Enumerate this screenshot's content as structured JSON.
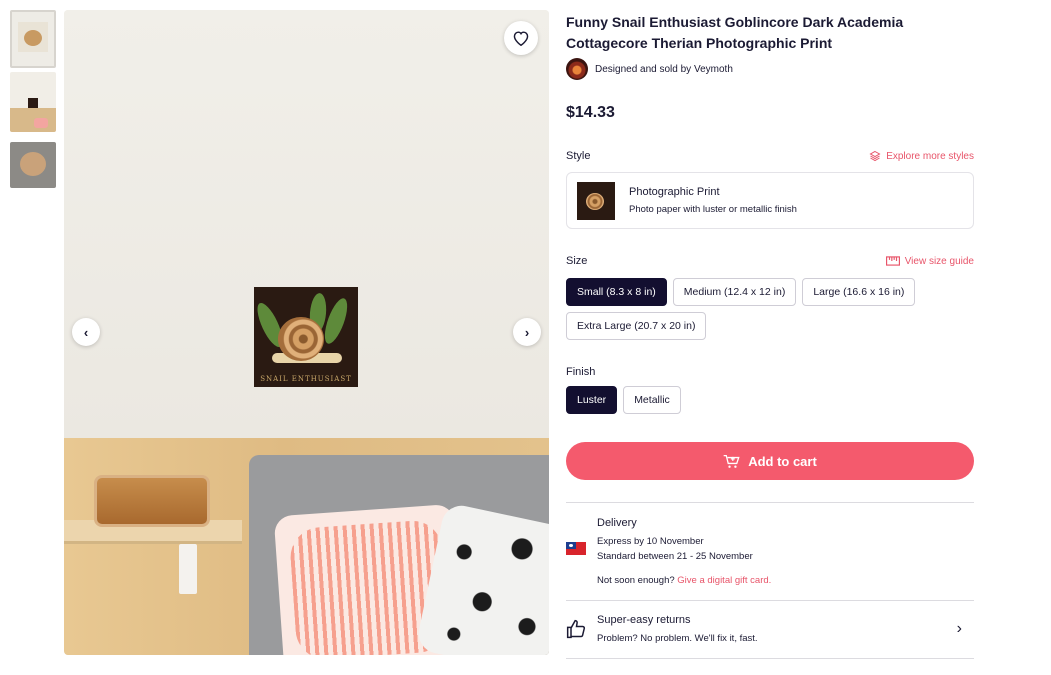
{
  "product": {
    "title": "Funny Snail Enthusiast Goblincore Dark Academia Cottagecore Therian Photographic Print",
    "seller_prefix": "Designed and sold by",
    "seller_name": "Veymoth",
    "price": "$14.33"
  },
  "gallery": {
    "art_caption": "SNAIL ENTHUSIAST",
    "prev_icon": "chevron-left-icon",
    "next_icon": "chevron-right-icon",
    "favorite_icon": "heart-icon"
  },
  "style": {
    "label": "Style",
    "explore_link": "Explore more styles",
    "selected_name": "Photographic Print",
    "selected_desc": "Photo paper with luster or metallic finish"
  },
  "size": {
    "label": "Size",
    "guide_link": "View size guide",
    "options": [
      {
        "label": "Small (8.3 x 8 in)",
        "selected": true
      },
      {
        "label": "Medium (12.4 x 12 in)",
        "selected": false
      },
      {
        "label": "Large (16.6 x 16 in)",
        "selected": false
      },
      {
        "label": "Extra Large (20.7 x 20 in)",
        "selected": false
      }
    ]
  },
  "finish": {
    "label": "Finish",
    "options": [
      {
        "label": "Luster",
        "selected": true
      },
      {
        "label": "Metallic",
        "selected": false
      }
    ]
  },
  "cart": {
    "label": "Add to cart"
  },
  "delivery": {
    "heading": "Delivery",
    "express": "Express by 10 November",
    "standard": "Standard between 21 - 25 November",
    "not_soon": "Not soon enough?",
    "gift_link": "Give a digital gift card."
  },
  "returns": {
    "heading": "Super-easy returns",
    "text": "Problem? No problem. We'll fix it, fast."
  },
  "colors": {
    "accent": "#f45a6d",
    "selected_chip": "#130f30"
  }
}
